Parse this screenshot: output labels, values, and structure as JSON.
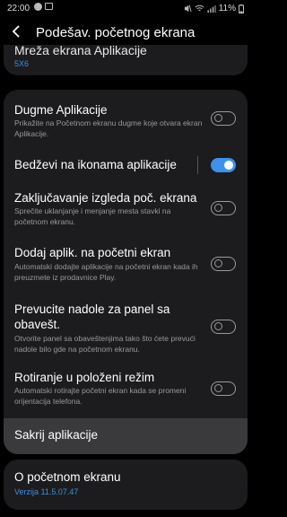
{
  "status_bar": {
    "time": "22:00",
    "battery": "11%"
  },
  "header": {
    "title": "Podešav. početnog ekrana"
  },
  "partial_item": {
    "title": "Mreža ekrana Aplikacije",
    "value": "5X6"
  },
  "settings": [
    {
      "title": "Dugme Aplikacije",
      "description": "Prikažite na Početnom ekranu dugme koje otvara ekran Aplikacije.",
      "on": false
    },
    {
      "title": "Bedževi na ikonama aplikacije",
      "description": "",
      "on": true
    },
    {
      "title": "Zaključavanje izgleda poč. ekrana",
      "description": "Sprečite uklanjanje i menjanje mesta stavki na početnom ekranu.",
      "on": false
    },
    {
      "title": "Dodaj aplik. na početni ekran",
      "description": "Automatski dodajte aplikacije na početni ekran kada ih preuzmete iz prodavnice Play.",
      "on": false
    },
    {
      "title": "Prevucite nadole za panel sa obavešt.",
      "description": "Otvorite panel sa obaveštenjima tako što ćete prevući nadole bilo gde na početnom ekranu.",
      "on": false
    },
    {
      "title": "Rotiranje u položeni režim",
      "description": "Automatski rotirajte početni ekran kada se promeni orijentacija telefona.",
      "on": false
    }
  ],
  "hide_apps": {
    "label": "Sakrij aplikacije"
  },
  "about": {
    "title": "O početnom ekranu",
    "version": "Verzija 11.5.07.47"
  }
}
